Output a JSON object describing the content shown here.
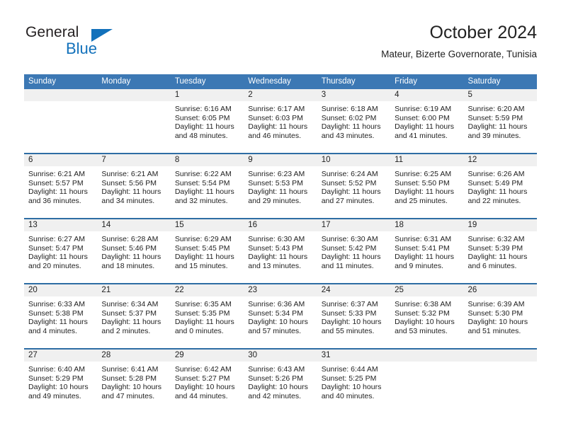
{
  "logo": {
    "word_top": "General",
    "word_bottom": "Blue",
    "triangle_icon": "blue-triangle-icon",
    "brand_color": "#1271bb"
  },
  "header": {
    "title": "October 2024",
    "subtitle": "Mateur, Bizerte Governorate, Tunisia",
    "header_bg_color": "#3c78b4",
    "week_divider_color": "#2e6da4",
    "daynum_band_color": "#f0f0f0"
  },
  "weekday_headers": [
    "Sunday",
    "Monday",
    "Tuesday",
    "Wednesday",
    "Thursday",
    "Friday",
    "Saturday"
  ],
  "weeks": [
    [
      {
        "day": "",
        "sunrise": "",
        "sunset": "",
        "daylight_line1": "",
        "daylight_line2": "",
        "empty": true
      },
      {
        "day": "",
        "sunrise": "",
        "sunset": "",
        "daylight_line1": "",
        "daylight_line2": "",
        "empty": true
      },
      {
        "day": "1",
        "sunrise": "Sunrise: 6:16 AM",
        "sunset": "Sunset: 6:05 PM",
        "daylight_line1": "Daylight: 11 hours",
        "daylight_line2": "and 48 minutes."
      },
      {
        "day": "2",
        "sunrise": "Sunrise: 6:17 AM",
        "sunset": "Sunset: 6:03 PM",
        "daylight_line1": "Daylight: 11 hours",
        "daylight_line2": "and 46 minutes."
      },
      {
        "day": "3",
        "sunrise": "Sunrise: 6:18 AM",
        "sunset": "Sunset: 6:02 PM",
        "daylight_line1": "Daylight: 11 hours",
        "daylight_line2": "and 43 minutes."
      },
      {
        "day": "4",
        "sunrise": "Sunrise: 6:19 AM",
        "sunset": "Sunset: 6:00 PM",
        "daylight_line1": "Daylight: 11 hours",
        "daylight_line2": "and 41 minutes."
      },
      {
        "day": "5",
        "sunrise": "Sunrise: 6:20 AM",
        "sunset": "Sunset: 5:59 PM",
        "daylight_line1": "Daylight: 11 hours",
        "daylight_line2": "and 39 minutes."
      }
    ],
    [
      {
        "day": "6",
        "sunrise": "Sunrise: 6:21 AM",
        "sunset": "Sunset: 5:57 PM",
        "daylight_line1": "Daylight: 11 hours",
        "daylight_line2": "and 36 minutes."
      },
      {
        "day": "7",
        "sunrise": "Sunrise: 6:21 AM",
        "sunset": "Sunset: 5:56 PM",
        "daylight_line1": "Daylight: 11 hours",
        "daylight_line2": "and 34 minutes."
      },
      {
        "day": "8",
        "sunrise": "Sunrise: 6:22 AM",
        "sunset": "Sunset: 5:54 PM",
        "daylight_line1": "Daylight: 11 hours",
        "daylight_line2": "and 32 minutes."
      },
      {
        "day": "9",
        "sunrise": "Sunrise: 6:23 AM",
        "sunset": "Sunset: 5:53 PM",
        "daylight_line1": "Daylight: 11 hours",
        "daylight_line2": "and 29 minutes."
      },
      {
        "day": "10",
        "sunrise": "Sunrise: 6:24 AM",
        "sunset": "Sunset: 5:52 PM",
        "daylight_line1": "Daylight: 11 hours",
        "daylight_line2": "and 27 minutes."
      },
      {
        "day": "11",
        "sunrise": "Sunrise: 6:25 AM",
        "sunset": "Sunset: 5:50 PM",
        "daylight_line1": "Daylight: 11 hours",
        "daylight_line2": "and 25 minutes."
      },
      {
        "day": "12",
        "sunrise": "Sunrise: 6:26 AM",
        "sunset": "Sunset: 5:49 PM",
        "daylight_line1": "Daylight: 11 hours",
        "daylight_line2": "and 22 minutes."
      }
    ],
    [
      {
        "day": "13",
        "sunrise": "Sunrise: 6:27 AM",
        "sunset": "Sunset: 5:47 PM",
        "daylight_line1": "Daylight: 11 hours",
        "daylight_line2": "and 20 minutes."
      },
      {
        "day": "14",
        "sunrise": "Sunrise: 6:28 AM",
        "sunset": "Sunset: 5:46 PM",
        "daylight_line1": "Daylight: 11 hours",
        "daylight_line2": "and 18 minutes."
      },
      {
        "day": "15",
        "sunrise": "Sunrise: 6:29 AM",
        "sunset": "Sunset: 5:45 PM",
        "daylight_line1": "Daylight: 11 hours",
        "daylight_line2": "and 15 minutes."
      },
      {
        "day": "16",
        "sunrise": "Sunrise: 6:30 AM",
        "sunset": "Sunset: 5:43 PM",
        "daylight_line1": "Daylight: 11 hours",
        "daylight_line2": "and 13 minutes."
      },
      {
        "day": "17",
        "sunrise": "Sunrise: 6:30 AM",
        "sunset": "Sunset: 5:42 PM",
        "daylight_line1": "Daylight: 11 hours",
        "daylight_line2": "and 11 minutes."
      },
      {
        "day": "18",
        "sunrise": "Sunrise: 6:31 AM",
        "sunset": "Sunset: 5:41 PM",
        "daylight_line1": "Daylight: 11 hours",
        "daylight_line2": "and 9 minutes."
      },
      {
        "day": "19",
        "sunrise": "Sunrise: 6:32 AM",
        "sunset": "Sunset: 5:39 PM",
        "daylight_line1": "Daylight: 11 hours",
        "daylight_line2": "and 6 minutes."
      }
    ],
    [
      {
        "day": "20",
        "sunrise": "Sunrise: 6:33 AM",
        "sunset": "Sunset: 5:38 PM",
        "daylight_line1": "Daylight: 11 hours",
        "daylight_line2": "and 4 minutes."
      },
      {
        "day": "21",
        "sunrise": "Sunrise: 6:34 AM",
        "sunset": "Sunset: 5:37 PM",
        "daylight_line1": "Daylight: 11 hours",
        "daylight_line2": "and 2 minutes."
      },
      {
        "day": "22",
        "sunrise": "Sunrise: 6:35 AM",
        "sunset": "Sunset: 5:35 PM",
        "daylight_line1": "Daylight: 11 hours",
        "daylight_line2": "and 0 minutes."
      },
      {
        "day": "23",
        "sunrise": "Sunrise: 6:36 AM",
        "sunset": "Sunset: 5:34 PM",
        "daylight_line1": "Daylight: 10 hours",
        "daylight_line2": "and 57 minutes."
      },
      {
        "day": "24",
        "sunrise": "Sunrise: 6:37 AM",
        "sunset": "Sunset: 5:33 PM",
        "daylight_line1": "Daylight: 10 hours",
        "daylight_line2": "and 55 minutes."
      },
      {
        "day": "25",
        "sunrise": "Sunrise: 6:38 AM",
        "sunset": "Sunset: 5:32 PM",
        "daylight_line1": "Daylight: 10 hours",
        "daylight_line2": "and 53 minutes."
      },
      {
        "day": "26",
        "sunrise": "Sunrise: 6:39 AM",
        "sunset": "Sunset: 5:30 PM",
        "daylight_line1": "Daylight: 10 hours",
        "daylight_line2": "and 51 minutes."
      }
    ],
    [
      {
        "day": "27",
        "sunrise": "Sunrise: 6:40 AM",
        "sunset": "Sunset: 5:29 PM",
        "daylight_line1": "Daylight: 10 hours",
        "daylight_line2": "and 49 minutes."
      },
      {
        "day": "28",
        "sunrise": "Sunrise: 6:41 AM",
        "sunset": "Sunset: 5:28 PM",
        "daylight_line1": "Daylight: 10 hours",
        "daylight_line2": "and 47 minutes."
      },
      {
        "day": "29",
        "sunrise": "Sunrise: 6:42 AM",
        "sunset": "Sunset: 5:27 PM",
        "daylight_line1": "Daylight: 10 hours",
        "daylight_line2": "and 44 minutes."
      },
      {
        "day": "30",
        "sunrise": "Sunrise: 6:43 AM",
        "sunset": "Sunset: 5:26 PM",
        "daylight_line1": "Daylight: 10 hours",
        "daylight_line2": "and 42 minutes."
      },
      {
        "day": "31",
        "sunrise": "Sunrise: 6:44 AM",
        "sunset": "Sunset: 5:25 PM",
        "daylight_line1": "Daylight: 10 hours",
        "daylight_line2": "and 40 minutes."
      },
      {
        "day": "",
        "sunrise": "",
        "sunset": "",
        "daylight_line1": "",
        "daylight_line2": "",
        "empty": true
      },
      {
        "day": "",
        "sunrise": "",
        "sunset": "",
        "daylight_line1": "",
        "daylight_line2": "",
        "empty": true
      }
    ]
  ]
}
